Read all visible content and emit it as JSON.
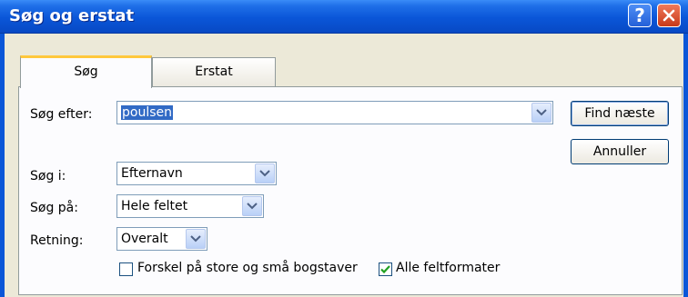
{
  "window": {
    "title": "Søg og erstat",
    "help_label": "?",
    "help_icon": "help-icon",
    "close_icon": "close-icon"
  },
  "tabs": [
    {
      "label": "Søg",
      "active": true
    },
    {
      "label": "Erstat",
      "active": false
    }
  ],
  "search": {
    "label": "Søg efter:",
    "value": "poulsen"
  },
  "search_in": {
    "label": "Søg i:",
    "value": "Efternavn"
  },
  "match": {
    "label": "Søg på:",
    "value": "Hele feltet"
  },
  "direction": {
    "label": "Retning:",
    "value": "Overalt"
  },
  "buttons": {
    "find_next": "Find næste",
    "cancel": "Annuller"
  },
  "options": {
    "case_sensitive": {
      "label": "Forskel på store og små bogstaver",
      "checked": false
    },
    "all_formats": {
      "label": "Alle feltformater",
      "checked": true
    }
  },
  "colors": {
    "titlebar": "#0a56d8",
    "dialog_bg": "#ece9d8",
    "selection": "#316ac5",
    "tab_highlight": "#ffc83c"
  }
}
